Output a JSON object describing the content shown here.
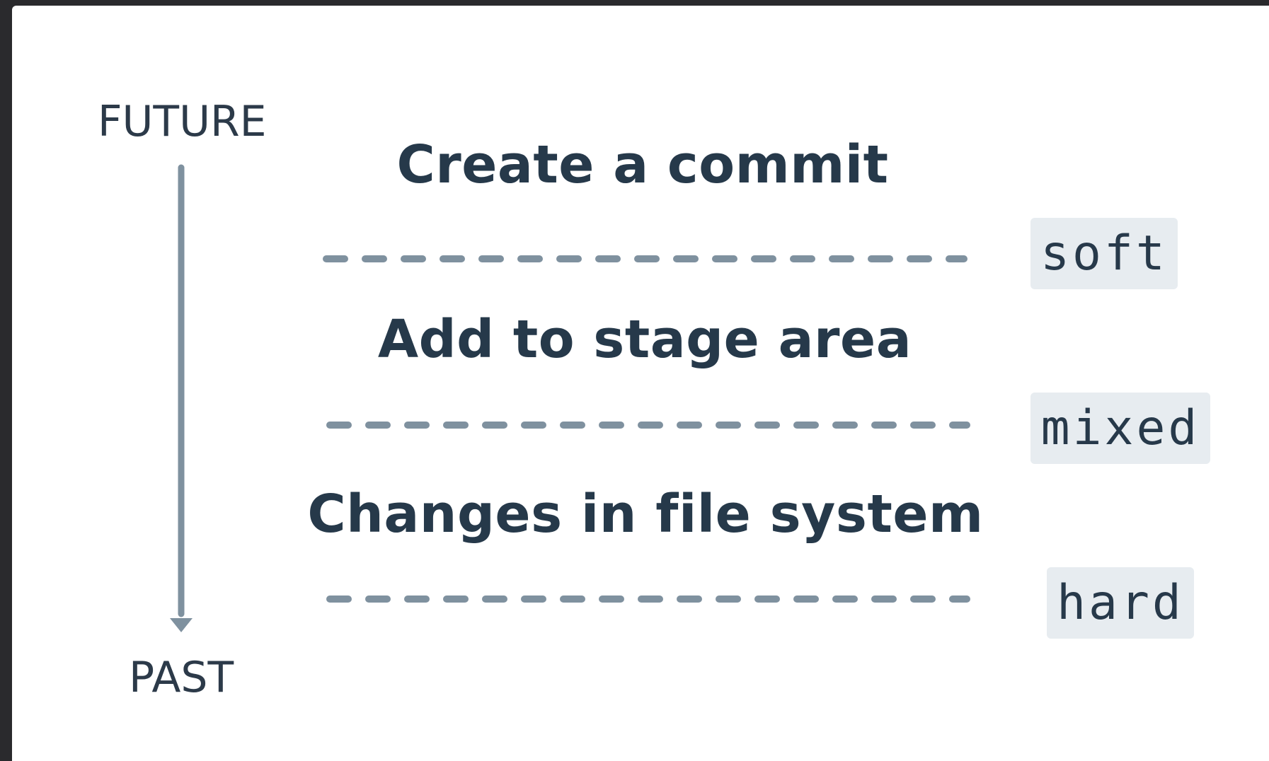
{
  "timeline": {
    "top_label": "FUTURE",
    "bottom_label": "PAST",
    "arrow_color": "#7f919f",
    "arrow_direction": "down"
  },
  "stages": [
    {
      "label": "Create a commit"
    },
    {
      "label": "Add to stage area"
    },
    {
      "label": "Changes in file system"
    }
  ],
  "reset_modes": [
    {
      "label": "soft"
    },
    {
      "label": "mixed"
    },
    {
      "label": "hard"
    }
  ],
  "colors": {
    "text": "#26394a",
    "dash": "#7f919f",
    "badge_bg": "#e7ecf0",
    "panel_bg": "#ffffff",
    "frame_bg": "#2a2a2d"
  }
}
